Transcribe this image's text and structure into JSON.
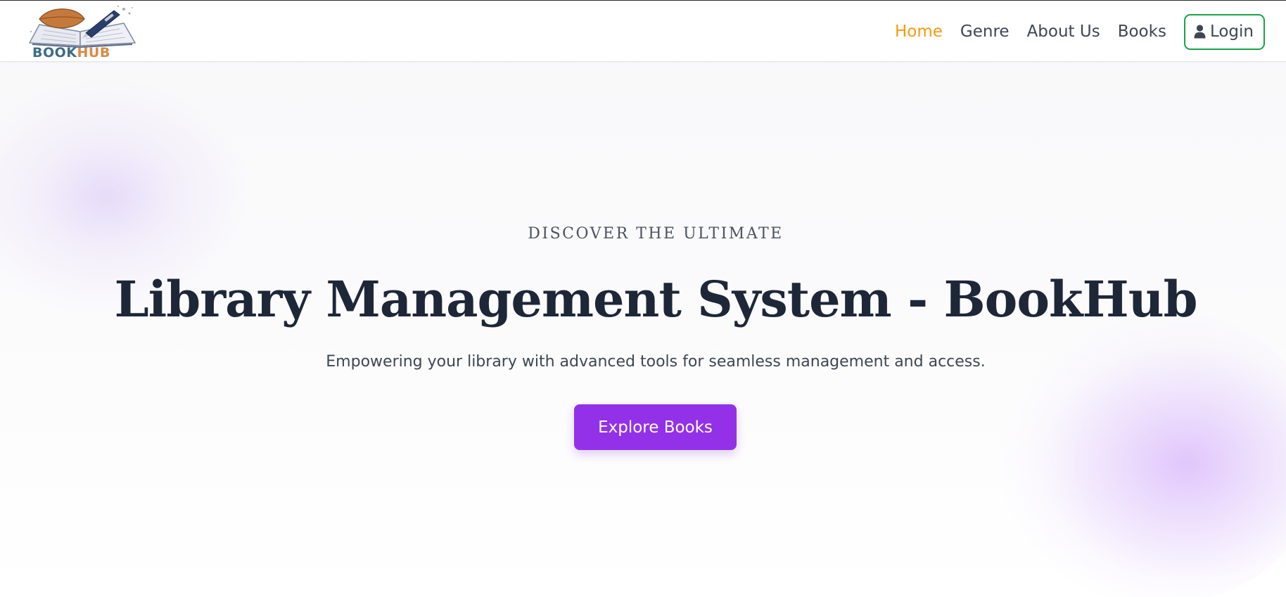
{
  "brand": {
    "logo_word_1": "BOOK",
    "logo_word_2": "HUB",
    "logo_icon": "open-book-with-leaf-and-pen-icon"
  },
  "nav": {
    "items": [
      {
        "label": "Home",
        "active": true
      },
      {
        "label": "Genre",
        "active": false
      },
      {
        "label": "About Us",
        "active": false
      },
      {
        "label": "Books",
        "active": false
      }
    ],
    "login_label": "Login",
    "login_icon": "user-icon"
  },
  "hero": {
    "eyebrow": "DISCOVER THE ULTIMATE",
    "title": "Library Management System - BookHub",
    "subtitle": "Empowering your library with advanced tools for seamless management and access.",
    "cta_label": "Explore Books"
  },
  "colors": {
    "active_nav": "#f59a0d",
    "login_border": "#17a34a",
    "cta_background": "#9331e9",
    "title_text": "#1d2738"
  }
}
